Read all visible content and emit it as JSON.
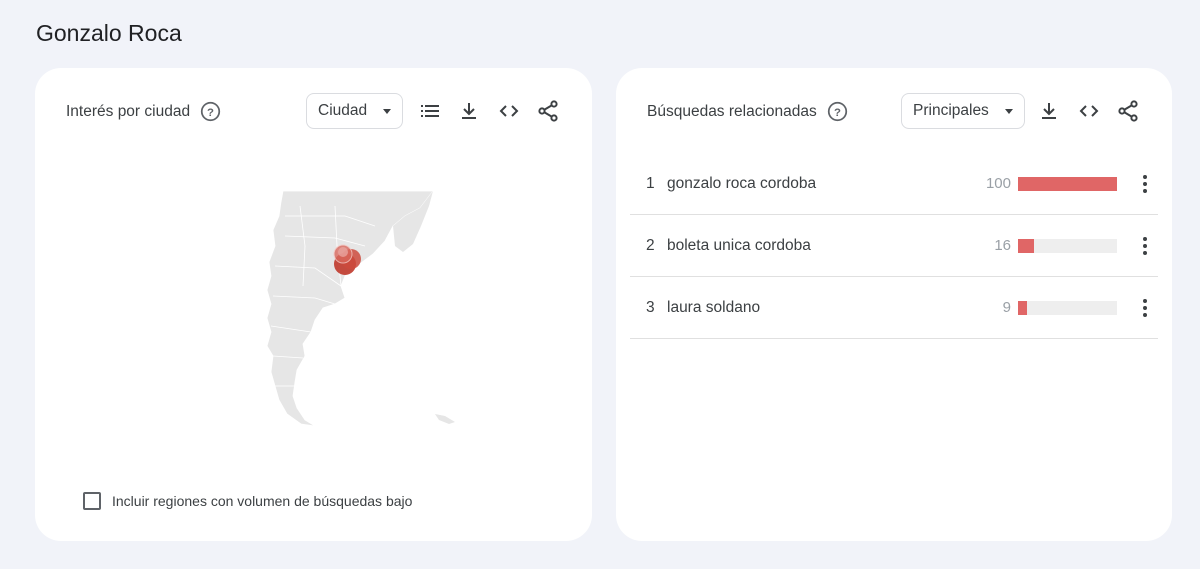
{
  "page": {
    "title": "Gonzalo Roca"
  },
  "interest_by_city": {
    "title": "Interés por ciudad",
    "dropdown_value": "Ciudad",
    "include_low_volume_label": "Incluir regiones con volumen de búsquedas bajo",
    "include_low_volume_checked": false
  },
  "related_searches": {
    "title": "Búsquedas relacionadas",
    "dropdown_value": "Principales",
    "rows": [
      {
        "rank": "1",
        "query": "gonzalo roca cordoba",
        "value": "100",
        "fraction": 1.0
      },
      {
        "rank": "2",
        "query": "boleta unica cordoba",
        "value": "16",
        "fraction": 0.16
      },
      {
        "rank": "3",
        "query": "laura soldano",
        "value": "9",
        "fraction": 0.09
      }
    ]
  },
  "colors": {
    "accent": "#e06666",
    "marker": "#c0392b",
    "map_land": "#e6e6e6"
  },
  "icons": [
    "help-icon",
    "list-icon",
    "download-icon",
    "embed-icon",
    "share-icon",
    "more-vert-icon",
    "caret-down-icon"
  ]
}
